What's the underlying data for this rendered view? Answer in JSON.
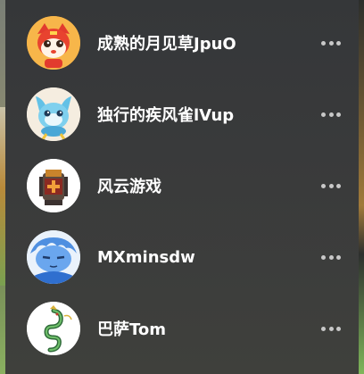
{
  "friends": [
    {
      "name": "成熟的月见草JpuO",
      "avatar_icon": "cartoon-tiger-avatar-icon",
      "more_icon": "more-options-icon"
    },
    {
      "name": "独行的疾风雀lVup",
      "avatar_icon": "blue-creature-avatar-icon",
      "more_icon": "more-options-icon"
    },
    {
      "name": "风云游戏",
      "avatar_icon": "knight-helmet-avatar-icon",
      "more_icon": "more-options-icon"
    },
    {
      "name": "MXminsdw",
      "avatar_icon": "blue-character-avatar-icon",
      "more_icon": "more-options-icon"
    },
    {
      "name": "巴萨Tom",
      "avatar_icon": "green-dragon-avatar-icon",
      "more_icon": "more-options-icon"
    }
  ],
  "colors": {
    "panel_bg": "#37393a",
    "text": "#ffffff",
    "more_dots": "#c8c8c8"
  }
}
